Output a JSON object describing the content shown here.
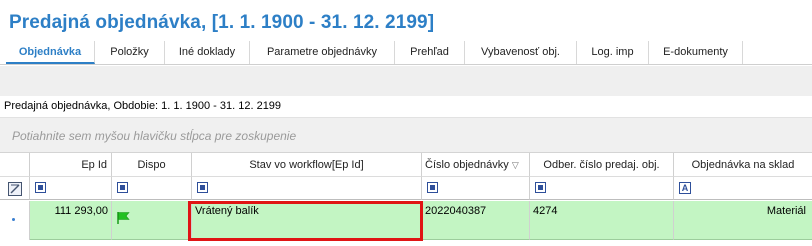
{
  "page": {
    "title": "Predajná objednávka,  [1. 1. 1900 - 31. 12. 2199]"
  },
  "tabs": [
    {
      "label": "Objednávka",
      "active": true
    },
    {
      "label": "Položky"
    },
    {
      "label": "Iné doklady"
    },
    {
      "label": "Parametre objednávky"
    },
    {
      "label": "Prehľad"
    },
    {
      "label": "Vybavenosť obj."
    },
    {
      "label": "Log. imp"
    },
    {
      "label": "E-dokumenty"
    }
  ],
  "filter_text": "Predajná objednávka, Obdobie: 1. 1. 1900 - 31. 12. 2199",
  "group_panel_placeholder": "Potiahnite sem myšou hlavičku stĺpca pre zoskupenie",
  "grid": {
    "columns": [
      {
        "label": "Ep Id"
      },
      {
        "label": "Dispo"
      },
      {
        "label": "Stav vo workflow[Ep Id]"
      },
      {
        "label": "Číslo objednávky"
      },
      {
        "label": "Odber. číslo predaj. obj."
      },
      {
        "label": "Objednávka na sklad"
      }
    ],
    "rows": [
      {
        "ep_id": "111 293,00",
        "dispo_icon": "green-flag-icon",
        "workflow_state": "Vrátený balík",
        "order_number": "2022040387",
        "customer_order_number": "4274",
        "warehouse_order": "Materiál"
      }
    ]
  },
  "colors": {
    "title": "#2d7fc6",
    "row_background": "#c3f5c3",
    "highlight_border": "#e01414",
    "flag": "#22c022"
  },
  "icons": {
    "sort_indicator": "▽",
    "filter_text_type": "A"
  }
}
